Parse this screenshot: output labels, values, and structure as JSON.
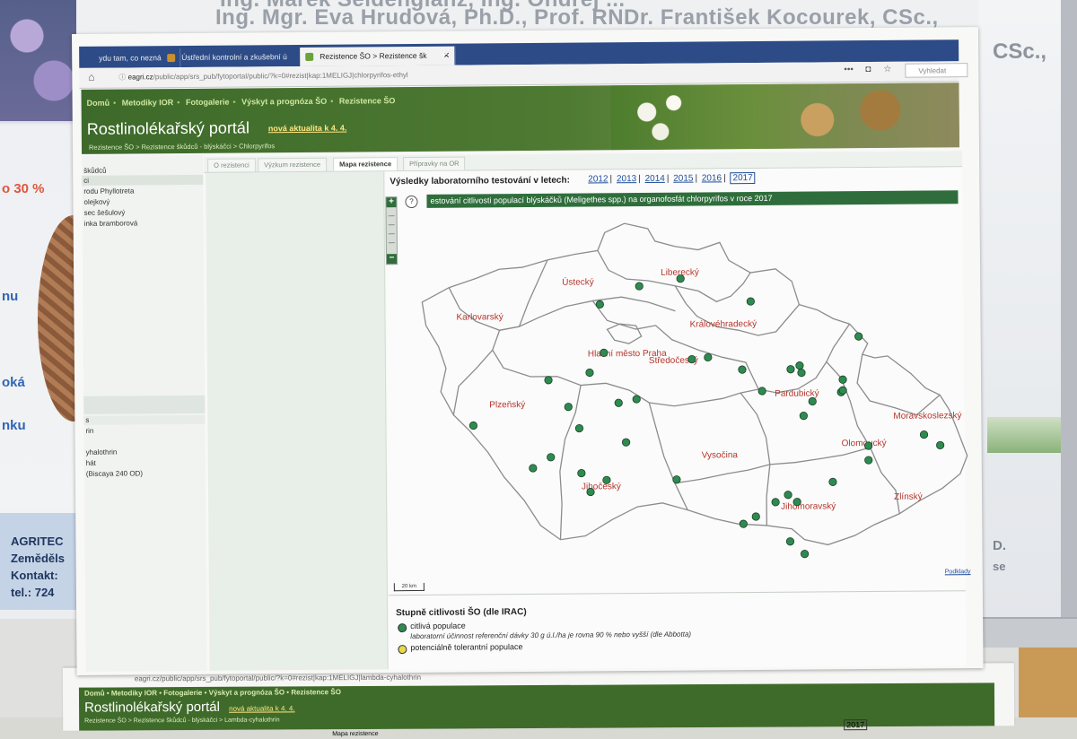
{
  "background": {
    "left_texts": [
      "o 30 %",
      "nu",
      "oká",
      "nku"
    ],
    "agritec_lines": [
      "AGRITEC",
      "Zeměděls",
      "Kontakt:",
      "tel.: 724"
    ],
    "top_names": "Ing. Mgr. Eva Hrudová, Ph.D., Prof. RNDr. František Kocourek, CSc.,",
    "top_names_partial": "Ing. Marek Seidenglanz, Ing. Ondřej ...",
    "right_texts": [
      "CSc.,",
      "D.",
      "se"
    ]
  },
  "browser": {
    "tabs": [
      {
        "label": "ydu tam, co nezná",
        "active": false
      },
      {
        "label": "Ústřední kontrolní a zkušební ú",
        "active": false
      },
      {
        "label": "Rezistence ŠO > Rezistence šk",
        "active": true
      }
    ],
    "new_tab": "+",
    "url_domain": "eagri.cz",
    "url_path": "/public/app/srs_pub/fytoportal/public/?k=0#rezist|kap:1MELIGJ|chlorpyrifos-ethyl",
    "search_placeholder": "Vyhledat",
    "icons": [
      "home-icon",
      "info-icon",
      "more-icon",
      "pocket-icon",
      "star-icon"
    ]
  },
  "portal": {
    "nav": [
      "Domů",
      "Metodiky IOR",
      "Fotogalerie",
      "Výskyt a prognóza ŠO",
      "Rezistence ŠO"
    ],
    "title": "Rostlinolékařský portál",
    "news_link": "nová aktualita k 4. 4.",
    "breadcrumb": "Rezistence ŠO > Rezistence škůdců - blýskáčci > Chlorpyrifos"
  },
  "sidebar": {
    "items": [
      "škůdců",
      "ci",
      "rodu Phyllotreta",
      "olejkový",
      "sec šešulový",
      "inka bramborová"
    ],
    "lower_items": [
      "s",
      "rin",
      "",
      "yhalothrin",
      "hát",
      "(Biscaya 240 OD)"
    ]
  },
  "content_tabs": [
    "O rezistenci",
    "Výzkum rezistence",
    "Mapa rezistence",
    "Přípravky na OR"
  ],
  "active_content_tab": "Mapa rezistence",
  "results": {
    "label": "Výsledky laboratorního testování v letech:",
    "years": [
      "2012",
      "2013",
      "2014",
      "2015",
      "2016",
      "2017"
    ],
    "current_year": "2017",
    "heading": "estování citlivosti populací blýskáčků (Meligethes spp.) na organofosfát chlorpyrifos v roce 2017"
  },
  "map": {
    "zoom_in": "+",
    "zoom_out": "−",
    "help": "?",
    "scale": "20 km",
    "source_link": "Podklady",
    "regions": [
      {
        "name": "Karlovarský"
      },
      {
        "name": "Ústecký"
      },
      {
        "name": "Liberecký"
      },
      {
        "name": "Královéhradecký"
      },
      {
        "name": "Hlavní město Praha"
      },
      {
        "name": "Středočeský"
      },
      {
        "name": "Plzeňský"
      },
      {
        "name": "Pardubický"
      },
      {
        "name": "Moravskoslezský"
      },
      {
        "name": "Olomoucký"
      },
      {
        "name": "Vysočina"
      },
      {
        "name": "Jihočeský"
      },
      {
        "name": "Jihomoravský"
      },
      {
        "name": "Zlínský"
      }
    ],
    "sensitive_color": "#2e8b50",
    "tolerant_color": "#e8d84a",
    "sensitive_site_count": 44
  },
  "legend": {
    "title": "Stupně citlivosti ŠO (dle IRAC)",
    "items": [
      {
        "label": "citlivá populace",
        "note": "laboratorní účinnost referenční dávky 30 g ú.l./ha je rovna 90 % nebo vyšší (dle Abbotta)",
        "color": "#2e8b50"
      },
      {
        "label": "potenciálně tolerantní populace",
        "note": "",
        "color": "#e8d84a"
      }
    ]
  },
  "second_sheet": {
    "url": "eagri.cz/public/app/srs_pub/fytoportal/public/?k=0#rezist|kap:1MELIGJ|lambda-cyhalothrin",
    "nav": "Domů • Metodiky IOR • Fotogalerie • Výskyt a prognóza ŠO • Rezistence ŠO",
    "title": "Rostlinolékařský portál",
    "news_link": "nová aktualita k 4. 4.",
    "breadcrumb": "Rezistence ŠO > Rezistence škůdců - blýskáčci > Lambda-cyhalothrin",
    "tab": "Mapa rezistence",
    "year_box": "2017"
  }
}
